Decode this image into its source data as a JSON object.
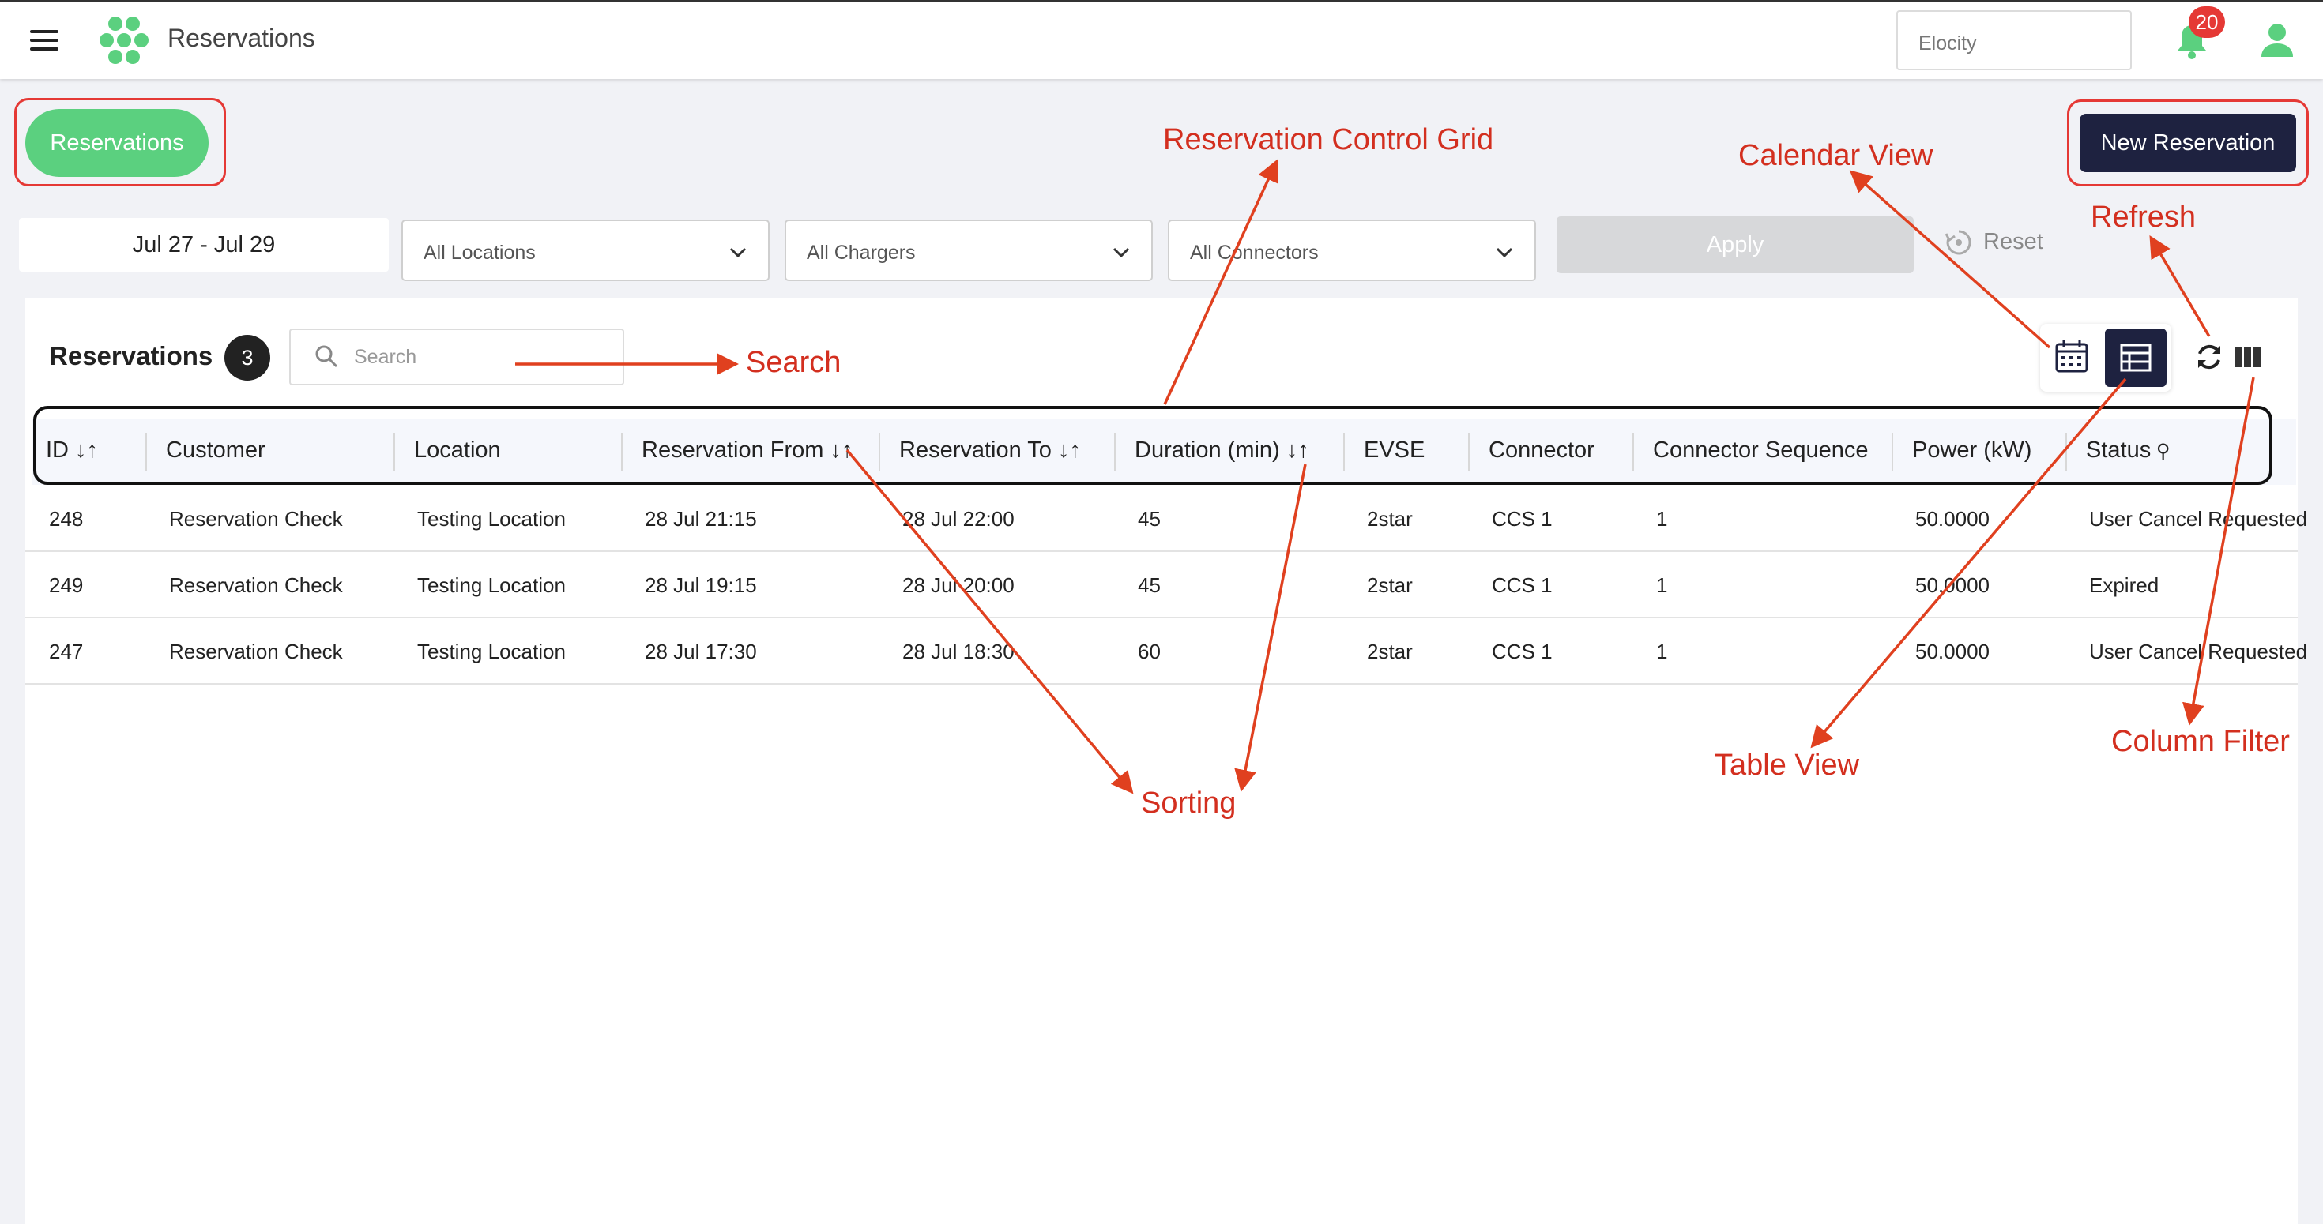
{
  "app": {
    "title": "Reservations",
    "org_value": "Elocity",
    "notification_count": "20"
  },
  "page": {
    "chip_label": "Reservations",
    "new_button": "New Reservation"
  },
  "filters": {
    "date_range": "Jul 27 - Jul 29",
    "locations": "All Locations",
    "chargers": "All Chargers",
    "connectors": "All Connectors",
    "apply": "Apply",
    "reset": "Reset"
  },
  "table": {
    "title": "Reservations",
    "count": "3",
    "search_placeholder": "Search",
    "columns": [
      "ID",
      "Customer",
      "Location",
      "Reservation From",
      "Reservation To",
      "Duration (min)",
      "EVSE",
      "Connector",
      "Connector Sequence",
      "Power (kW)",
      "Status"
    ],
    "rows": [
      [
        "248",
        "Reservation Check",
        "Testing Location",
        "28 Jul 21:15",
        "28 Jul 22:00",
        "45",
        "2star",
        "CCS 1",
        "1",
        "50.0000",
        "User Cancel Requested"
      ],
      [
        "249",
        "Reservation Check",
        "Testing Location",
        "28 Jul 19:15",
        "28 Jul 20:00",
        "45",
        "2star",
        "CCS 1",
        "1",
        "50.0000",
        "Expired"
      ],
      [
        "247",
        "Reservation Check",
        "Testing Location",
        "28 Jul 17:30",
        "28 Jul 18:30",
        "60",
        "2star",
        "CCS 1",
        "1",
        "50.0000",
        "User Cancel Requested"
      ]
    ]
  },
  "annotations": {
    "control_grid": "Reservation Control Grid",
    "calendar_view": "Calendar View",
    "refresh": "Refresh",
    "search": "Search",
    "sorting": "Sorting",
    "table_view": "Table View",
    "column_filter": "Column Filter"
  },
  "colors": {
    "brand_green": "#5bd07f",
    "navy": "#1e2240",
    "annotation_red": "#d32f1f",
    "badge_red": "#e53935"
  }
}
